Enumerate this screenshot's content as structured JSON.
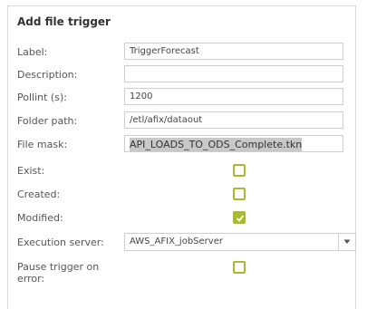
{
  "dialog": {
    "title": "Add file trigger"
  },
  "fields": {
    "label": {
      "label": "Label:",
      "value": "TriggerForecast"
    },
    "description": {
      "label": "Description:",
      "value": ""
    },
    "pollint": {
      "label": "Pollint (s):",
      "value": "1200"
    },
    "folder_path": {
      "label": "Folder path:",
      "value": "/etl/afix/dataout"
    },
    "file_mask": {
      "label": "File mask:",
      "value": "API_LOADS_TO_ODS_Complete.tkn"
    }
  },
  "checks": {
    "exist": {
      "label": "Exist:",
      "checked": false
    },
    "created": {
      "label": "Created:",
      "checked": false
    },
    "modified": {
      "label": "Modified:",
      "checked": true
    },
    "pause": {
      "label_line1": "Pause trigger on",
      "label_line2": "error:",
      "checked": false
    }
  },
  "execution_server": {
    "label": "Execution server:",
    "value": "AWS_AFIX_jobServer"
  },
  "colors": {
    "accent": "#a6bc2b",
    "border": "#cfcfcf"
  }
}
